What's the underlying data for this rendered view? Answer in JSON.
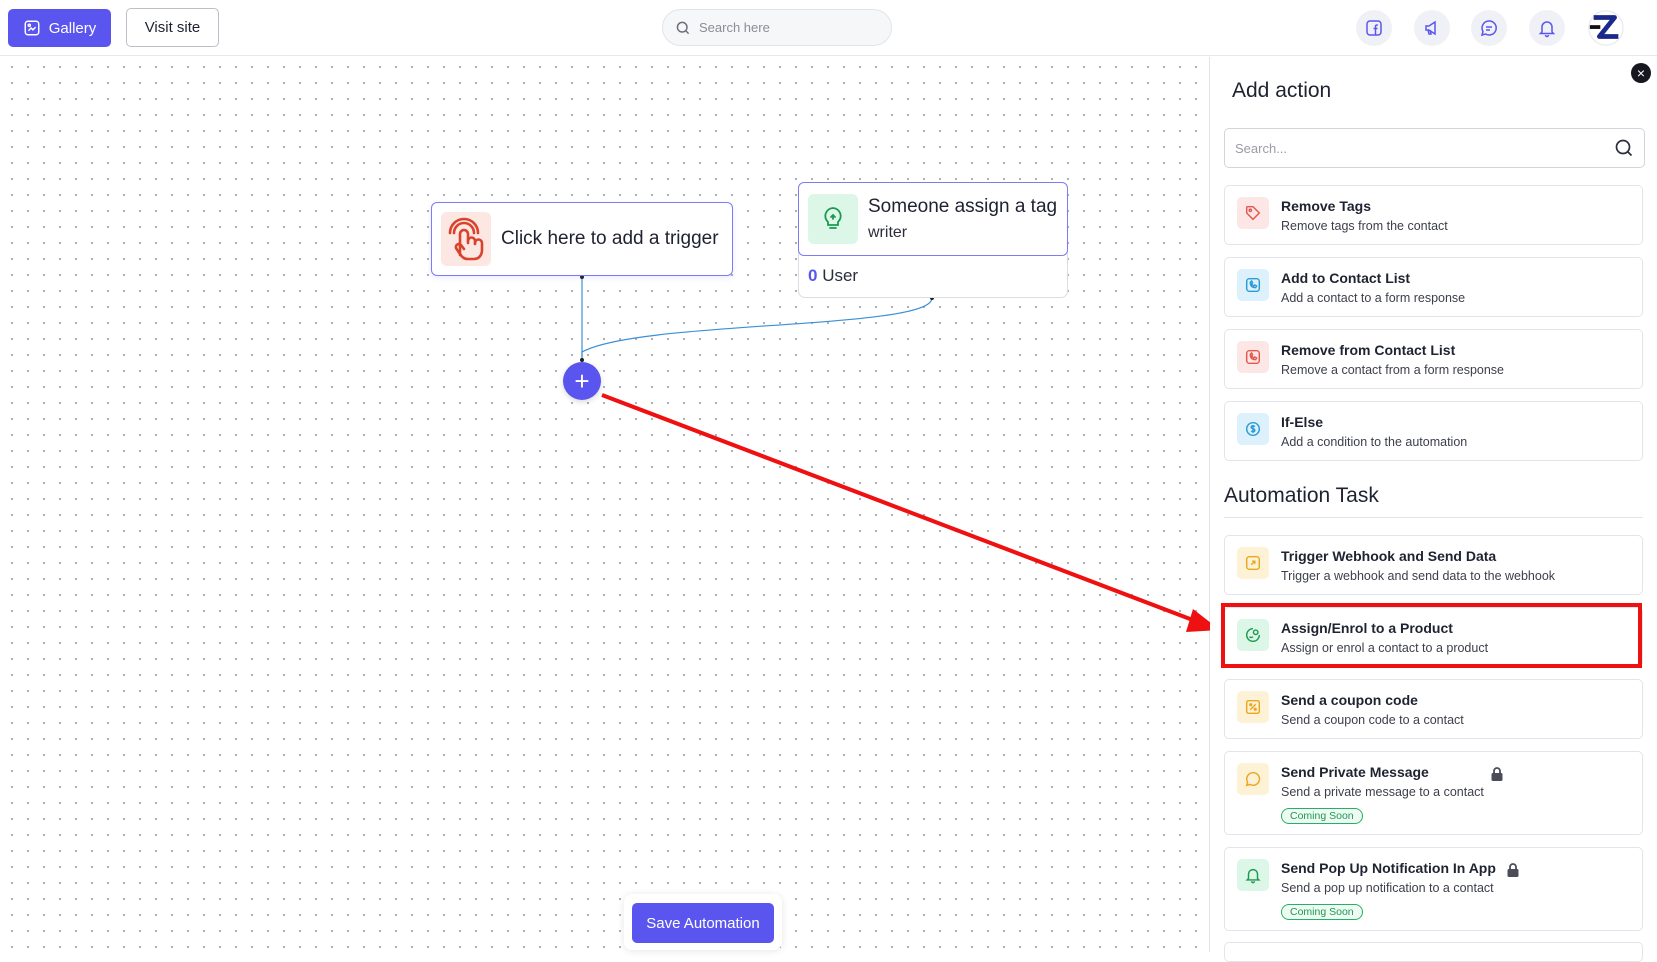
{
  "topbar": {
    "gallery_label": "Gallery",
    "visit_site_label": "Visit site",
    "search_placeholder": "Search here",
    "icons": [
      "facebook-icon",
      "megaphone-icon",
      "chat-icon",
      "bell-icon"
    ]
  },
  "canvas": {
    "trigger_node": {
      "label": "Click here to add a trigger"
    },
    "tag_node": {
      "title": "Someone assign a tag",
      "subtitle": "writer",
      "user_count": "0",
      "user_label": "User"
    },
    "add_button_symbol": "+",
    "save_label": "Save Automation"
  },
  "panel": {
    "title": "Add action",
    "search_placeholder": "Search...",
    "close_symbol": "×",
    "actions": [
      {
        "title": "Remove Tags",
        "desc": "Remove tags from the contact"
      },
      {
        "title": "Add to Contact List",
        "desc": "Add a contact to a form response"
      },
      {
        "title": "Remove from Contact List",
        "desc": "Remove a contact from a form response"
      },
      {
        "title": "If-Else",
        "desc": "Add a condition to the automation"
      }
    ],
    "automation_section_title": "Automation Task",
    "tasks": [
      {
        "title": "Trigger Webhook and Send Data",
        "desc": "Trigger a webhook and send data to the webhook"
      },
      {
        "title": "Assign/Enrol to a Product",
        "desc": "Assign or enrol a contact to a product"
      },
      {
        "title": "Send a coupon code",
        "desc": "Send a coupon code to a contact"
      },
      {
        "title": "Send Private Message",
        "desc": "Send a private message to a contact",
        "badge": "Coming Soon"
      },
      {
        "title": "Send Pop Up Notification In App",
        "desc": "Send a pop up notification to a contact",
        "badge": "Coming Soon"
      }
    ]
  },
  "colors": {
    "primary": "#5b55f0",
    "annotation_red": "#ef1111",
    "badge_green": "#22b35e"
  }
}
